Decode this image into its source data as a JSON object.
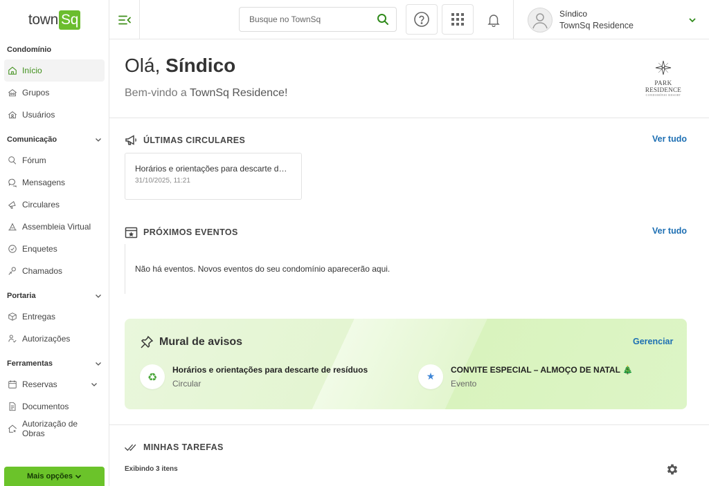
{
  "app": {
    "logo_text": "town",
    "logo_box": "Sq"
  },
  "sidebar": {
    "sections": [
      {
        "label": "Condomínio",
        "items": [
          {
            "label": "Início",
            "icon": "home-icon",
            "active": true
          },
          {
            "label": "Grupos",
            "icon": "groups-icon"
          },
          {
            "label": "Usuários",
            "icon": "users-icon"
          }
        ]
      },
      {
        "label": "Comunicação",
        "items": [
          {
            "label": "Fórum",
            "icon": "forum-icon"
          },
          {
            "label": "Mensagens",
            "icon": "messages-icon"
          },
          {
            "label": "Circulares",
            "icon": "megaphone-icon"
          },
          {
            "label": "Assembleia Virtual",
            "icon": "assembly-icon"
          },
          {
            "label": "Enquetes",
            "icon": "poll-icon"
          },
          {
            "label": "Chamados",
            "icon": "tickets-icon"
          }
        ]
      },
      {
        "label": "Portaria",
        "items": [
          {
            "label": "Entregas",
            "icon": "package-icon"
          },
          {
            "label": "Autorizações",
            "icon": "authorization-icon"
          }
        ]
      },
      {
        "label": "Ferramentas",
        "items": [
          {
            "label": "Reservas",
            "icon": "calendar-icon"
          },
          {
            "label": "Documentos",
            "icon": "document-icon"
          },
          {
            "label": "Autorização de Obras",
            "icon": "construction-icon"
          }
        ]
      }
    ],
    "more_button": "Mais opções"
  },
  "header": {
    "search_placeholder": "Busque no TownSq",
    "user_name": "Síndico",
    "user_condo": "TownSq Residence"
  },
  "main": {
    "greeting_prefix": "Olá, ",
    "greeting_name": "Síndico",
    "welcome_prefix": "Bem-vindo a ",
    "welcome_condo": "TownSq Residence!",
    "condo_logo": {
      "line1": "PARK",
      "line2": "RESIDENCE",
      "line3": "CONDOMÍNIO RESORT"
    },
    "circulares": {
      "title": "ÚLTIMAS CIRCULARES",
      "see_all": "Ver tudo",
      "card_title": "Horários e orientações para descarte de resíduos",
      "card_date": "31/10/2025, 11:21"
    },
    "eventos": {
      "title": "PRÓXIMOS EVENTOS",
      "see_all": "Ver tudo",
      "empty": "Não há eventos. Novos eventos do seu condomínio aparecerão aqui."
    },
    "mural": {
      "title": "Mural de avisos",
      "manage": "Gerenciar",
      "items": [
        {
          "title": "Horários e orientações para descarte de resíduos",
          "type": "Circular",
          "icon": "recycle-icon"
        },
        {
          "title": "CONVITE ESPECIAL – ALMOÇO DE NATAL 🎄",
          "type": "Evento",
          "icon": "star-icon"
        }
      ]
    },
    "tarefas": {
      "title": "MINHAS TAREFAS",
      "count": "Exibindo 3 itens"
    }
  },
  "colors": {
    "brand_green": "#6bbd2e",
    "link_blue": "#1d6fb3",
    "active_green": "#3f8f1a"
  }
}
